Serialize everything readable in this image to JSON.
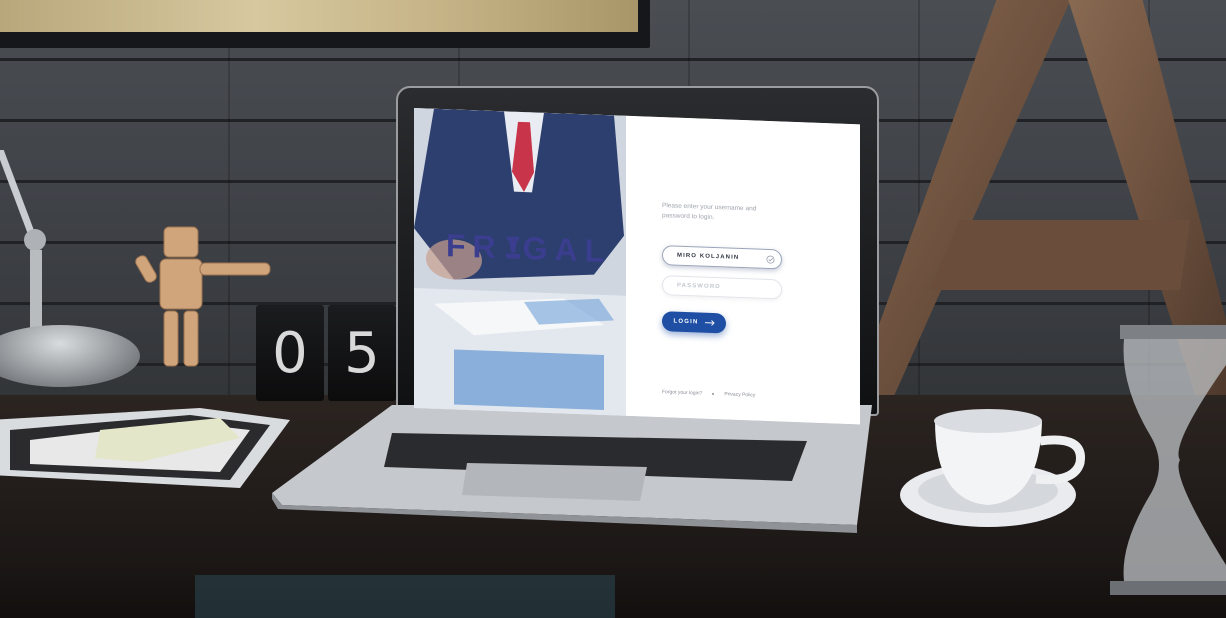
{
  "brand": {
    "name_left": "FR",
    "name_right": "GAL",
    "logo_icon": "chess-piece-icon",
    "color": "#3b3d8f"
  },
  "login_form": {
    "prompt": "Please enter your username and password to login.",
    "username": {
      "value": "MIRO KOLJANIN",
      "status_icon": "check-circle-icon"
    },
    "password": {
      "placeholder": "PASSWORD"
    },
    "login_button": {
      "label": "LOGIN",
      "icon": "arrow-right-icon",
      "color": "#1f4fa4"
    },
    "footer": {
      "forgot_link": "Forgot your login?",
      "privacy_link": "Privacy Policy"
    }
  },
  "scene": {
    "clock_digits": [
      "0",
      "5"
    ]
  }
}
